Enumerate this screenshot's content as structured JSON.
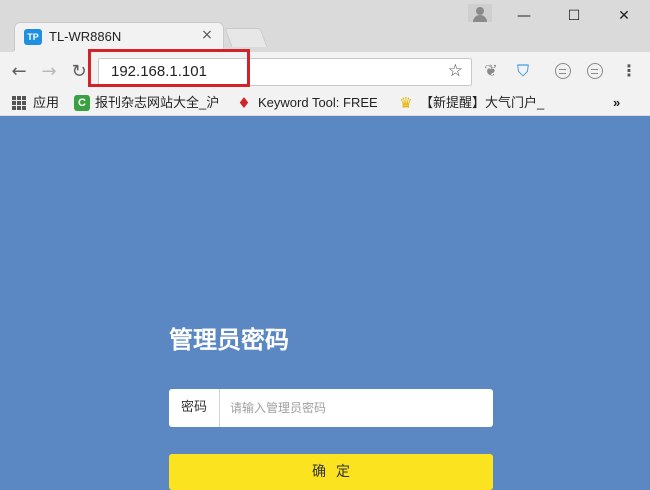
{
  "window": {
    "tab_title": "TL-WR886N",
    "tab_icon_text": "TP",
    "minimize": "—",
    "maximize": "☐",
    "close": "✕"
  },
  "toolbar": {
    "url": "192.168.1.101"
  },
  "bookmarks": [
    {
      "label": "应用",
      "icon": "apps-icon"
    },
    {
      "label": "报刊杂志网站大全_沪",
      "icon": "green-c-icon"
    },
    {
      "label": "Keyword Tool: FREE",
      "icon": "red-flame-icon"
    },
    {
      "label": "【新提醒】大气门户_",
      "icon": "gold-trophy-icon"
    },
    {
      "label": "»",
      "icon": "overflow-chevron"
    }
  ],
  "login": {
    "title": "管理员密码",
    "password_label": "密码",
    "password_placeholder": "请输入管理员密码",
    "confirm_label": "确定"
  },
  "colors": {
    "page_background": "#5b87c3",
    "confirm_button": "#fbe31f",
    "highlight": "#d2232a"
  }
}
